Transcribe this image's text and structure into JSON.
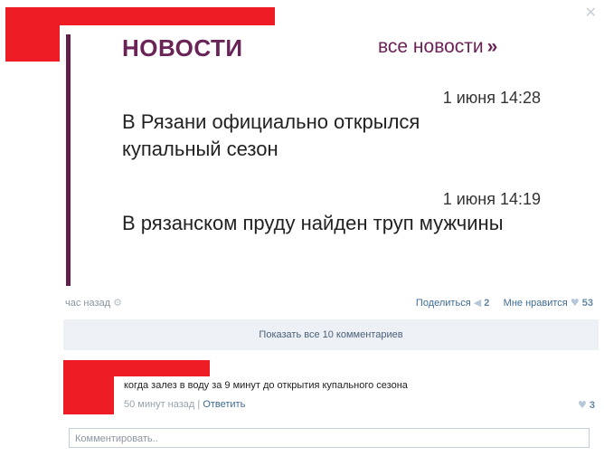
{
  "close_icon": "✕",
  "news": {
    "heading": "НОВОСТИ",
    "all_news": "все новости",
    "arrows": "»",
    "items": [
      {
        "time": "1 июня 14:28",
        "title": "В Рязани официально открылся купальный сезон"
      },
      {
        "time": "1 июня 14:19",
        "title": "В рязанском пруду найден труп мужчины"
      }
    ]
  },
  "post_meta": {
    "time": "час назад",
    "share_label": "Поделиться",
    "share_count": "2",
    "like_label": "Мне нравится",
    "like_count": "53"
  },
  "show_all_comments": "Показать все 10 комментариев",
  "comment": {
    "text": "когда залез в воду за 9 минут до открытия купального сезона",
    "time": "50 минут назад",
    "separator": "|",
    "reply": "Ответить",
    "likes": "3"
  },
  "comment_input": {
    "placeholder": "Комментировать.."
  },
  "colors": {
    "redaction": "#ee1c25",
    "news_accent": "#6a2356",
    "link": "#3f6b94"
  }
}
